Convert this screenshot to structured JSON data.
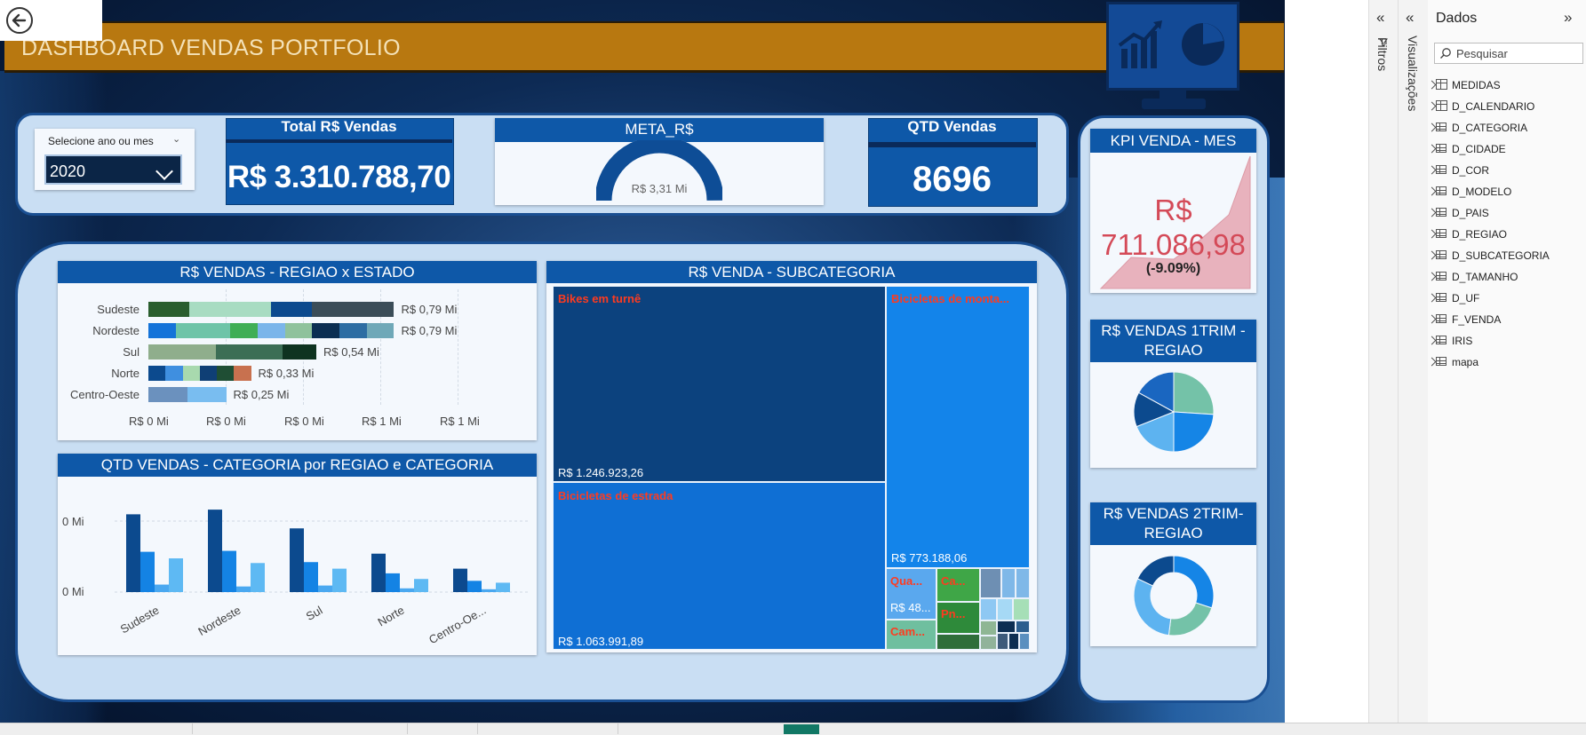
{
  "dashboard": {
    "title": "DASHBOARD VENDAS PORTFOLIO",
    "slicer": {
      "label": "Selecione ano ou mes",
      "value": "2020"
    },
    "kpis": {
      "total_title": "Total R$ Vendas",
      "total_value": "R$ 3.310.788,70",
      "meta_title": "META_R$",
      "meta_value": "R$ 3,31 Mi",
      "meta_fraction": 1.0,
      "qtd_title": "QTD Vendas",
      "qtd_value": "8696"
    }
  },
  "region_chart": {
    "title": "R$ VENDAS - REGIAO x ESTADO",
    "rows": [
      {
        "region": "Sudeste",
        "label": "R$ 0,79 Mi",
        "value": 0.79
      },
      {
        "region": "Nordeste",
        "label": "R$ 0,79 Mi",
        "value": 0.79
      },
      {
        "region": "Sul",
        "label": "R$ 0,54 Mi",
        "value": 0.54
      },
      {
        "region": "Norte",
        "label": "R$ 0,33 Mi",
        "value": 0.33
      },
      {
        "region": "Centro-Oeste",
        "label": "R$ 0,25 Mi",
        "value": 0.25
      }
    ],
    "ticks": [
      "R$ 0 Mi",
      "R$ 0 Mi",
      "R$ 0 Mi",
      "R$ 1 Mi",
      "R$ 1 Mi"
    ]
  },
  "qtd_chart": {
    "title": "QTD VENDAS - CATEGORIA por REGIAO e CATEGORIA",
    "yticks": [
      "0 Mi",
      "0 Mi"
    ],
    "categories": [
      "Sudeste",
      "Nordeste",
      "Sul",
      "Norte",
      "Centro-Oe..."
    ]
  },
  "treemap": {
    "title": "R$ VENDA - SUBCATEGORIA",
    "tiles": [
      {
        "label": "Bikes em turnê",
        "value": "R$ 1.246.923,26"
      },
      {
        "label": "Bicicletas de estrada",
        "value": "R$ 1.063.991,89"
      },
      {
        "label": "Bicicletas de monta...",
        "value": "R$ 773.188,06"
      },
      {
        "label": "Qua...",
        "value": "R$ 48..."
      },
      {
        "label": "Ca...",
        "value": ""
      },
      {
        "label": "Pn...",
        "value": ""
      },
      {
        "label": "Cam...",
        "value": ""
      }
    ]
  },
  "kpi_mes": {
    "title": "KPI VENDA - MES",
    "line1": "R$",
    "line2": "711.086,98",
    "delta": "(-9.09%)"
  },
  "pie1": {
    "title_line1": "R$ VENDAS 1TRIM -",
    "title_line2": "REGIAO"
  },
  "donut2": {
    "title_line1": "R$ VENDAS 2TRIM-",
    "title_line2": "REGIAO"
  },
  "pbi": {
    "filters_label": "Filtros",
    "viz_label": "Visualizações",
    "data_title": "Dados",
    "search_placeholder": "Pesquisar",
    "fields": [
      "MEDIDAS",
      "D_CALENDARIO",
      "D_CATEGORIA",
      "D_CIDADE",
      "D_COR",
      "D_MODELO",
      "D_PAIS",
      "D_REGIAO",
      "D_SUBCATEGORIA",
      "D_TAMANHO",
      "D_UF",
      "F_VENDA",
      "IRIS",
      "mapa"
    ]
  },
  "chart_data": [
    {
      "type": "bar",
      "title": "R$ VENDAS - REGIAO x ESTADO",
      "orientation": "horizontal",
      "categories": [
        "Sudeste",
        "Nordeste",
        "Sul",
        "Norte",
        "Centro-Oeste"
      ],
      "values": [
        0.79,
        0.79,
        0.54,
        0.33,
        0.25
      ],
      "unit": "R$ Mi",
      "stacked": true,
      "xlim": [
        0,
        1.2
      ]
    },
    {
      "type": "bar",
      "title": "QTD VENDAS - CATEGORIA por REGIAO e CATEGORIA",
      "categories": [
        "Sudeste",
        "Nordeste",
        "Sul",
        "Norte",
        "Centro-Oe..."
      ],
      "series": [
        {
          "values": [
            83,
            88,
            68,
            41,
            25
          ]
        },
        {
          "values": [
            43,
            44,
            32,
            20,
            12
          ]
        },
        {
          "values": [
            8,
            6,
            7,
            4,
            3
          ]
        },
        {
          "values": [
            36,
            31,
            25,
            14,
            10
          ]
        }
      ],
      "colors": [
        "#0c4a8e",
        "#1483e4",
        "#4aa8f0",
        "#5eb9f3"
      ]
    },
    {
      "type": "table",
      "title": "R$ VENDA - SUBCATEGORIA",
      "categories": [
        "Bikes em turnê",
        "Bicicletas de estrada",
        "Bicicletas de monta..."
      ],
      "values": [
        1246923.26,
        1063991.89,
        773188.06
      ]
    },
    {
      "type": "pie",
      "title": "R$ VENDAS 1TRIM - REGIAO",
      "values": [
        26,
        24,
        19,
        14,
        17
      ],
      "colors": [
        "#74c2a8",
        "#1585e6",
        "#5db3f0",
        "#0c4a8e",
        "#1a66c0"
      ]
    },
    {
      "type": "pie",
      "title": "R$ VENDAS 2TRIM- REGIAO",
      "donut": true,
      "values": [
        30,
        22,
        30,
        18
      ],
      "colors": [
        "#1585e6",
        "#74c2a8",
        "#5db3f0",
        "#0c4a8e"
      ]
    }
  ]
}
